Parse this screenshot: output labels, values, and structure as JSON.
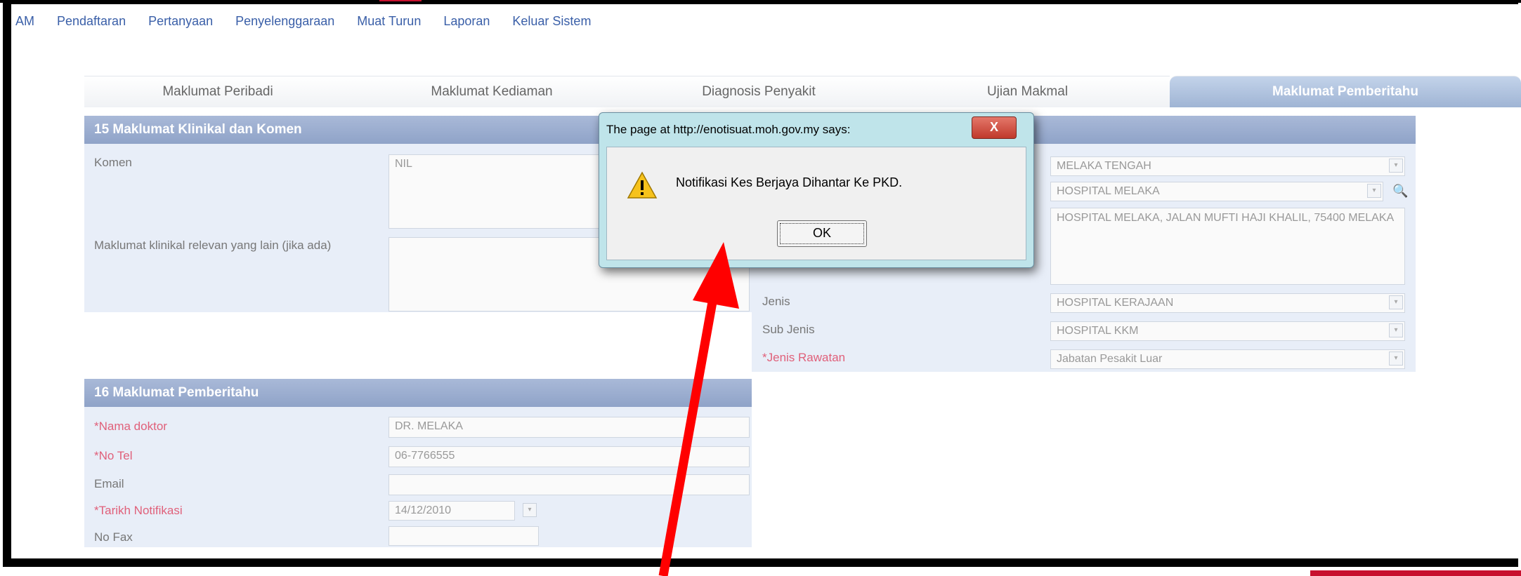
{
  "menu": [
    "AM",
    "Pendaftaran",
    "Pertanyaan",
    "Penyelenggaraan",
    "Muat Turun",
    "Laporan",
    "Keluar Sistem"
  ],
  "tabs": [
    {
      "label": "Maklumat Peribadi"
    },
    {
      "label": "Maklumat Kediaman"
    },
    {
      "label": "Diagnosis Penyakit"
    },
    {
      "label": "Ujian Makmal"
    },
    {
      "label": "Maklumat Pemberitahu",
      "active": true
    }
  ],
  "section15": {
    "title": "15 Maklumat Klinikal dan Komen",
    "komen_label": "Komen",
    "komen_value": "NIL",
    "klinikal_label": "Maklumat klinikal relevan yang lain (jika ada)",
    "klinikal_value": ""
  },
  "facility": {
    "daerah_value": "MELAKA TENGAH",
    "nama_value": "HOSPITAL MELAKA",
    "alamat_value": "HOSPITAL MELAKA, JALAN MUFTI HAJI KHALIL, 75400 MELAKA",
    "jenis_label": "Jenis",
    "jenis_value": "HOSPITAL KERAJAAN",
    "subjenis_label": "Sub Jenis",
    "subjenis_value": "HOSPITAL KKM",
    "rawatan_label": "*Jenis Rawatan",
    "rawatan_value": "Jabatan Pesakit Luar"
  },
  "section16": {
    "title": "16 Maklumat Pemberitahu",
    "doktor_label": "*Nama doktor",
    "doktor_value": "DR. MELAKA",
    "tel_label": "*No Tel",
    "tel_value": "06-7766555",
    "email_label": "Email",
    "email_value": "",
    "tarikh_label": "*Tarikh Notifikasi",
    "tarikh_value": "14/12/2010",
    "fax_label": "No Fax",
    "fax_value": ""
  },
  "dialog": {
    "title": "The page at http://enotisuat.moh.gov.my says:",
    "close": "X",
    "message": "Notifikasi Kes Berjaya Dihantar Ke PKD.",
    "ok": "OK",
    "icon": "warning-icon"
  },
  "colors": {
    "menu_link": "#3a5fa8",
    "section_header": "#9fb1d2",
    "required_label": "#e0607a",
    "arrow": "#ff0000",
    "dialog_frame": "#bfe4ea"
  }
}
